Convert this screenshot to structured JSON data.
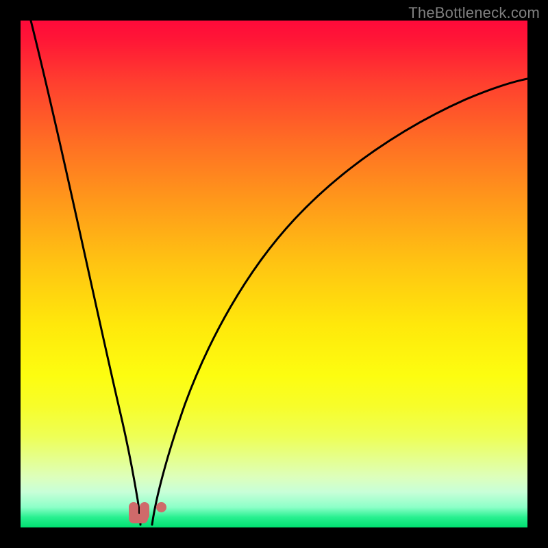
{
  "watermark": "TheBottleneck.com",
  "colors": {
    "page_bg": "#000000",
    "watermark": "#808080",
    "curve": "#000000",
    "marker": "#cf6a6a",
    "gradient_top": "#ff0a3a",
    "gradient_bottom": "#00e070"
  },
  "chart_data": {
    "type": "line",
    "title": "",
    "xlabel": "",
    "ylabel": "",
    "xlim": [
      0,
      100
    ],
    "ylim": [
      0,
      100
    ],
    "grid": false,
    "legend": false,
    "series": [
      {
        "name": "left-curve",
        "x": [
          2,
          5,
          8,
          11,
          14,
          16,
          18,
          19.5,
          21,
          22,
          22.8
        ],
        "y": [
          100,
          86,
          72,
          56,
          40,
          27,
          16,
          9,
          4,
          1.5,
          0.5
        ]
      },
      {
        "name": "right-curve",
        "x": [
          25,
          26.5,
          28.5,
          31,
          34,
          38,
          43,
          49,
          56,
          64,
          73,
          83,
          94,
          100
        ],
        "y": [
          0.5,
          4,
          10,
          18,
          27,
          37,
          47,
          56,
          64,
          71,
          77,
          82,
          86,
          88
        ]
      }
    ],
    "markers": [
      {
        "name": "u-marker-bottom",
        "shape": "u",
        "x_range": [
          21.0,
          24.3
        ],
        "y_range": [
          0.5,
          4.5
        ]
      },
      {
        "name": "dot-marker",
        "shape": "dot",
        "x": 27.3,
        "y": 3.2
      }
    ]
  }
}
